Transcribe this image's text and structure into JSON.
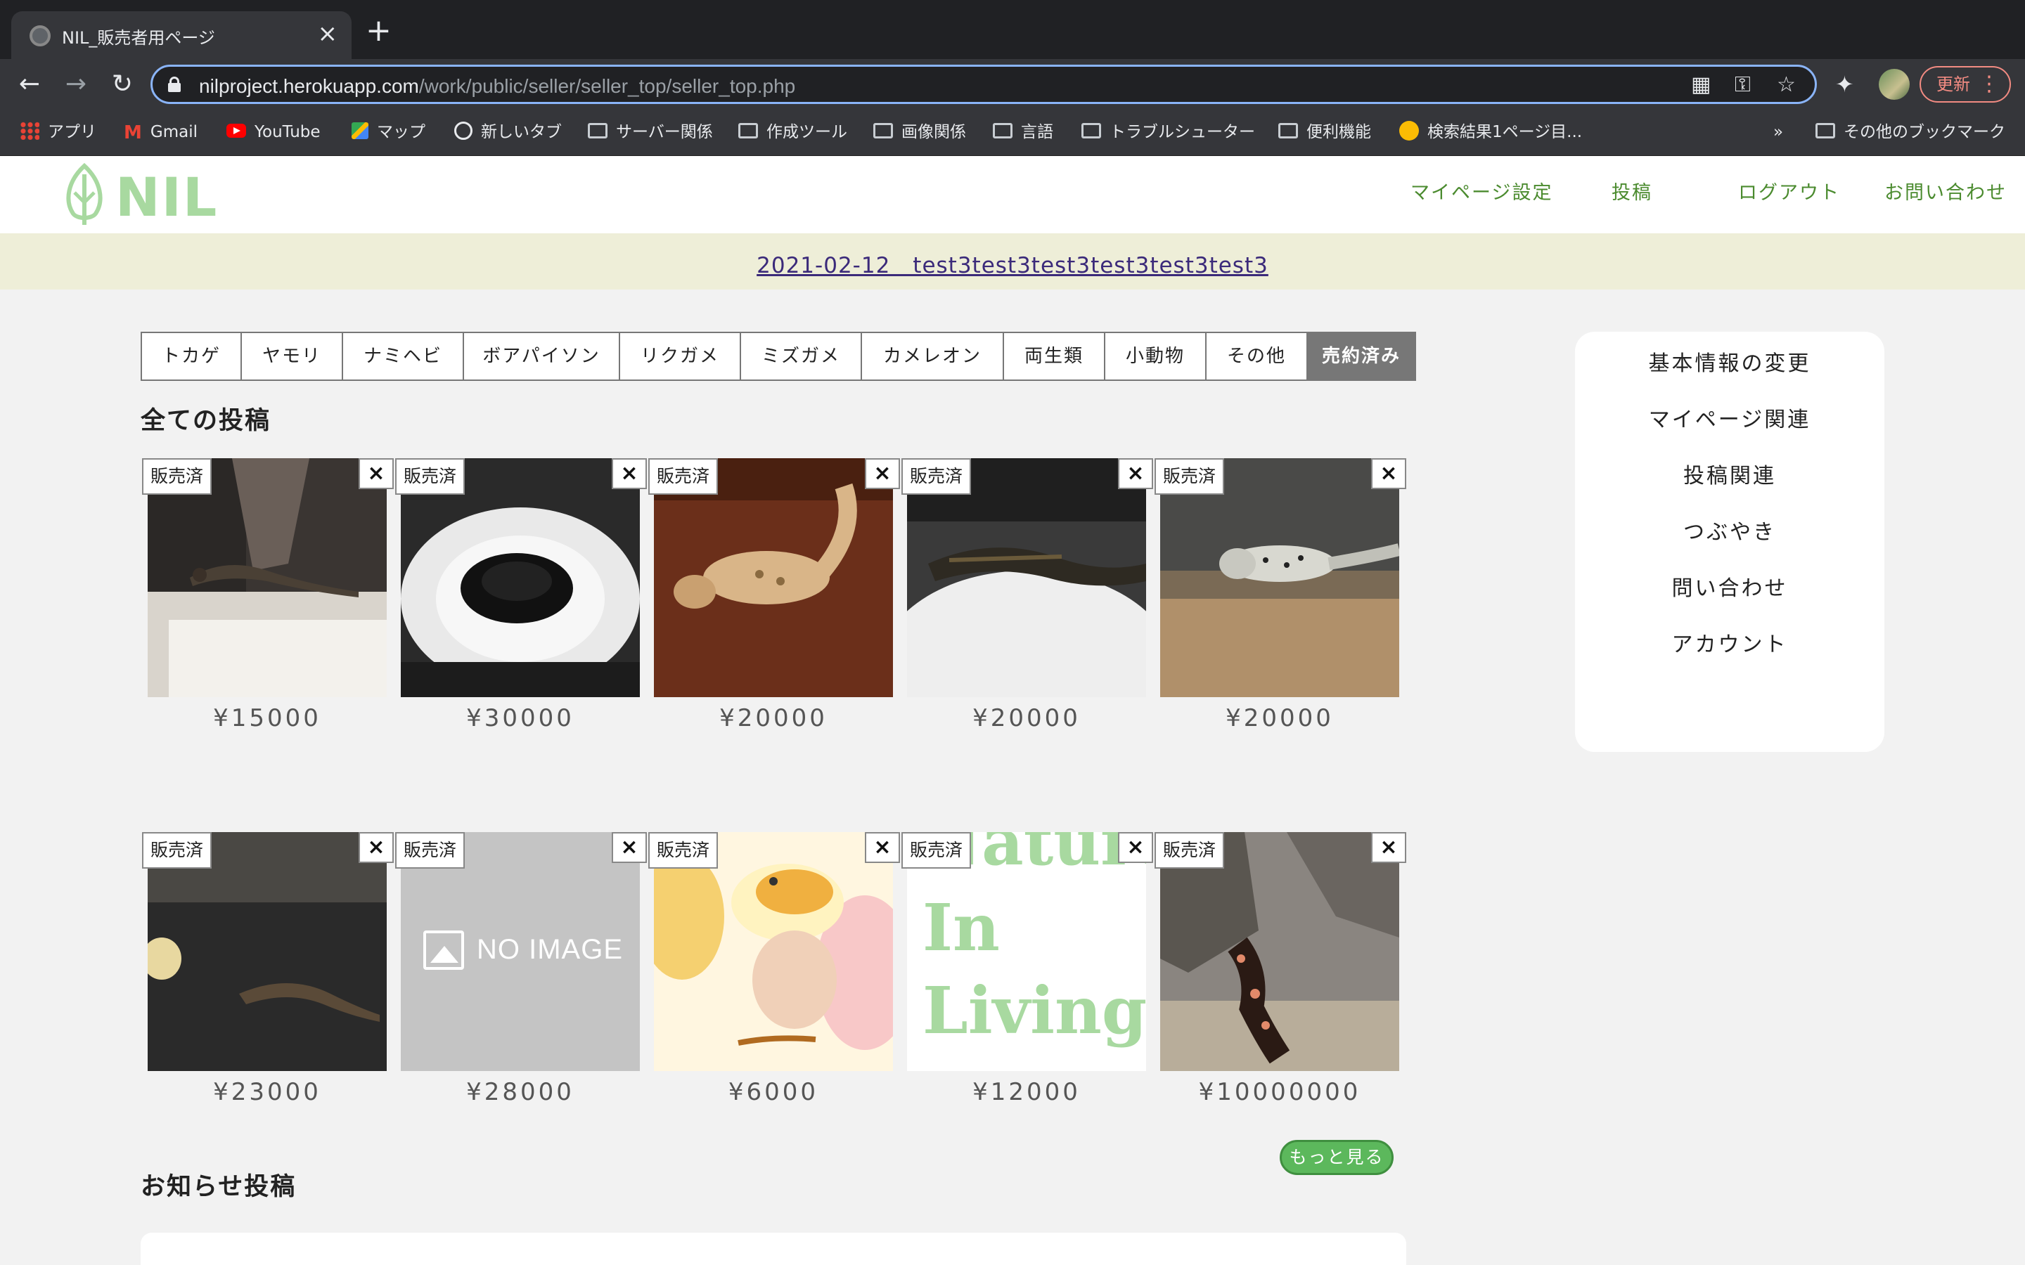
{
  "browser": {
    "tab_title": "NIL_販売者用ページ",
    "url_host": "nilproject.herokuapp.com",
    "url_path": "/work/public/seller/seller_top/seller_top.php",
    "update_label": "更新",
    "bookmarks": [
      {
        "label": "アプリ",
        "icon": "apps-grid-icon"
      },
      {
        "label": "Gmail",
        "icon": "gmail-icon"
      },
      {
        "label": "YouTube",
        "icon": "youtube-icon"
      },
      {
        "label": "マップ",
        "icon": "maps-icon"
      },
      {
        "label": "新しいタブ",
        "icon": "globe-icon"
      },
      {
        "label": "サーバー関係",
        "icon": "folder-icon"
      },
      {
        "label": "作成ツール",
        "icon": "folder-icon"
      },
      {
        "label": "画像関係",
        "icon": "folder-icon"
      },
      {
        "label": "言語",
        "icon": "folder-icon"
      },
      {
        "label": "トラブルシューター",
        "icon": "folder-icon"
      },
      {
        "label": "便利機能",
        "icon": "folder-icon"
      },
      {
        "label": "検索結果1ページ目...",
        "icon": "smiley-icon"
      }
    ],
    "bookmarks_overflow": "»",
    "other_bookmarks": "その他のブックマーク"
  },
  "site": {
    "logo_text": "NIL",
    "brand_color": "#a8d9a0",
    "nav": [
      "マイページ設定",
      "投稿",
      "ログアウト",
      "お問い合わせ"
    ],
    "notice": "2021-02-12　test3test3test3test3test3test3"
  },
  "categories": [
    "トカゲ",
    "ヤモリ",
    "ナミヘビ",
    "ボアパイソン",
    "リクガメ",
    "ミズガメ",
    "カメレオン",
    "両生類",
    "小動物",
    "その他",
    "売約済み"
  ],
  "active_category": "売約済み",
  "all_posts_title": "全ての投稿",
  "sold_label": "販売済",
  "delete_label": "×",
  "products": [
    {
      "price": "¥15000",
      "image": "tegu-on-white-ledge"
    },
    {
      "price": "¥30000",
      "image": "black-snake-coiled"
    },
    {
      "price": "¥20000",
      "image": "leopard-gecko-tan"
    },
    {
      "price": "¥20000",
      "image": "spiny-lizard-on-white-substrate"
    },
    {
      "price": "¥20000",
      "image": "leopard-gecko-spotted"
    },
    {
      "price": "¥23000",
      "image": "lizard-on-black-gravel"
    },
    {
      "price": "¥28000",
      "image": "no-image-placeholder"
    },
    {
      "price": "¥6000",
      "image": "bright-gecko-with-worm"
    },
    {
      "price": "¥12000",
      "image": "nature-in-living-logo"
    },
    {
      "price": "¥10000000",
      "image": "gila-monster-on-rocks"
    }
  ],
  "no_image_text": "NO IMAGE",
  "nature_logo_lines": [
    "Nature",
    "In",
    "Living"
  ],
  "more_button": "もっと見る",
  "news_title": "お知らせ投稿",
  "side_menu": [
    "基本情報の変更",
    "マイページ関連",
    "投稿関連",
    "つぶやき",
    "問い合わせ",
    "アカウント"
  ]
}
